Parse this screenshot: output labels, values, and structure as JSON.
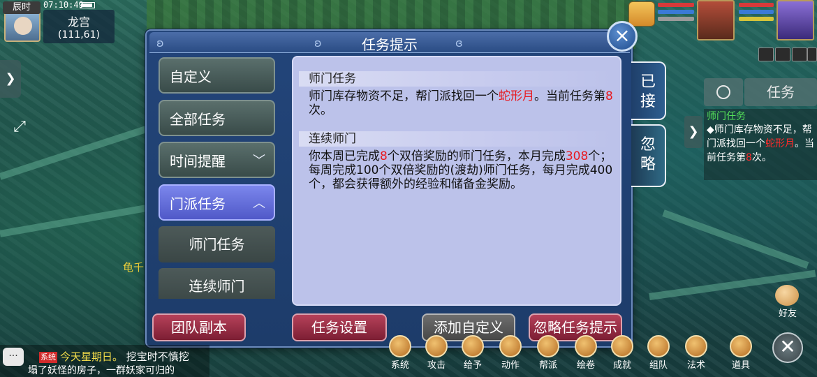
{
  "hud": {
    "time_tag": "辰时",
    "clock": "07:10:49",
    "location": "龙宫",
    "coords": "(111,61)"
  },
  "dialog": {
    "title": "任务提示",
    "close_icon": "×",
    "menu": [
      {
        "label": "自定义"
      },
      {
        "label": "全部任务"
      },
      {
        "label": "时间提醒",
        "icon": "chevron-down"
      },
      {
        "label": "门派任务",
        "icon": "chevron-up",
        "selected": true
      }
    ],
    "submenu": [
      {
        "label": "师门任务"
      },
      {
        "label": "连续师门"
      }
    ],
    "sections": [
      {
        "heading": "师门任务",
        "parts": [
          {
            "text": "师门库存物资不足，帮门派找回一个"
          },
          {
            "text": "蛇形月",
            "color": "#e8191f"
          },
          {
            "text": "。当前任务第"
          },
          {
            "text": "8",
            "color": "#e8191f"
          },
          {
            "text": "次。"
          }
        ]
      },
      {
        "heading": "连续师门",
        "parts": [
          {
            "text": "你本周已完成"
          },
          {
            "text": "8",
            "color": "#e8191f"
          },
          {
            "text": "个双倍奖励的师门任务，本月完成"
          },
          {
            "text": "308",
            "color": "#e8191f"
          },
          {
            "text": "个；每周完成100个双倍奖励的(渡劫)师门任务，每月完成400个，都会获得额外的经验和储备金奖励。"
          }
        ]
      }
    ],
    "side_tabs": {
      "accepted": "已接",
      "ignored": "忽略"
    },
    "buttons": {
      "team_dungeon": "团队副本",
      "task_settings": "任务设置",
      "add_custom": "添加自定义",
      "ignore_prompt": "忽略任务提示"
    }
  },
  "tracker": {
    "tab_label": "任务",
    "title": "师门任务",
    "body_prefix": "◆师门库存物资不足，帮门派找回一个",
    "item": "蛇形月",
    "body_mid": "。当前任务第",
    "count": "8",
    "body_suffix": "次。"
  },
  "bottom_bar": [
    "系统",
    "攻击",
    "给予",
    "动作",
    "帮派",
    "绘卷",
    "成就",
    "组队",
    "法术",
    "道具"
  ],
  "friend_label": "好友",
  "chat": {
    "tag": "系统",
    "line1_yellow": "今天星期日。",
    "line1_white": "挖宝时不慎挖",
    "line2": "塌了妖怪的房子，一群妖家可归的"
  },
  "npc_name": "龟千",
  "colors": {
    "accent_red": "#e8191f",
    "selected_menu": "#6670dc",
    "content_bg": "#bcc2ea"
  }
}
